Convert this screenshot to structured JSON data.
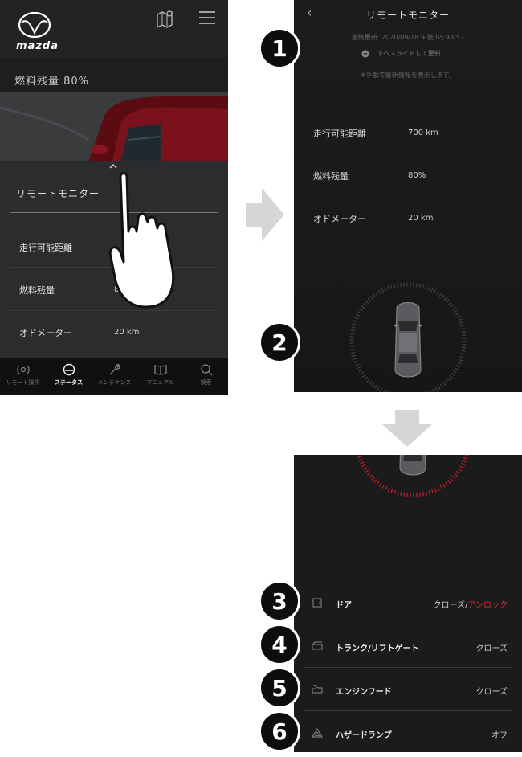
{
  "screen1": {
    "logo_text": "mazda",
    "fuel_header": "燃料残量 80%",
    "panel_title": "リモートモニター",
    "rows": [
      {
        "label": "走行可能距離",
        "value": ""
      },
      {
        "label": "燃料残量",
        "value": "80%"
      },
      {
        "label": "オドメーター",
        "value": "20 km"
      }
    ],
    "nav": [
      {
        "label": "リモート操作",
        "icon": "remote-icon"
      },
      {
        "label": "ステータス",
        "icon": "status-icon",
        "active": true
      },
      {
        "label": "メンテナンス",
        "icon": "wrench-icon"
      },
      {
        "label": "マニュアル",
        "icon": "book-icon"
      },
      {
        "label": "検索",
        "icon": "search-icon"
      }
    ]
  },
  "screen2": {
    "title": "リモートモニター",
    "last_update": "最終更新: 2020/09/18 午後 05:48:57",
    "slide_hint": "下へスライドして更新",
    "manual_hint": "※手動で最新情報を表示します。",
    "rows": [
      {
        "label": "走行可能距離",
        "value": "700 km"
      },
      {
        "label": "燃料残量",
        "value": "80%"
      },
      {
        "label": "オドメーター",
        "value": "20 km"
      }
    ]
  },
  "screen3": {
    "rows": [
      {
        "label": "ドア",
        "value_main": "クローズ/",
        "value_alert": "アンロック",
        "icon": "door-icon"
      },
      {
        "label": "トランク/リフトゲート",
        "value_main": "クローズ",
        "value_alert": "",
        "icon": "trunk-icon"
      },
      {
        "label": "エンジンフード",
        "value_main": "クローズ",
        "value_alert": "",
        "icon": "hood-icon"
      },
      {
        "label": "ハザードランプ",
        "value_main": "オフ",
        "value_alert": "",
        "icon": "hazard-icon"
      }
    ]
  },
  "badges": [
    "1",
    "2",
    "3",
    "4",
    "5",
    "6"
  ],
  "colors": {
    "alert_red": "#e0263a",
    "background_dark": "#1d1e20"
  }
}
